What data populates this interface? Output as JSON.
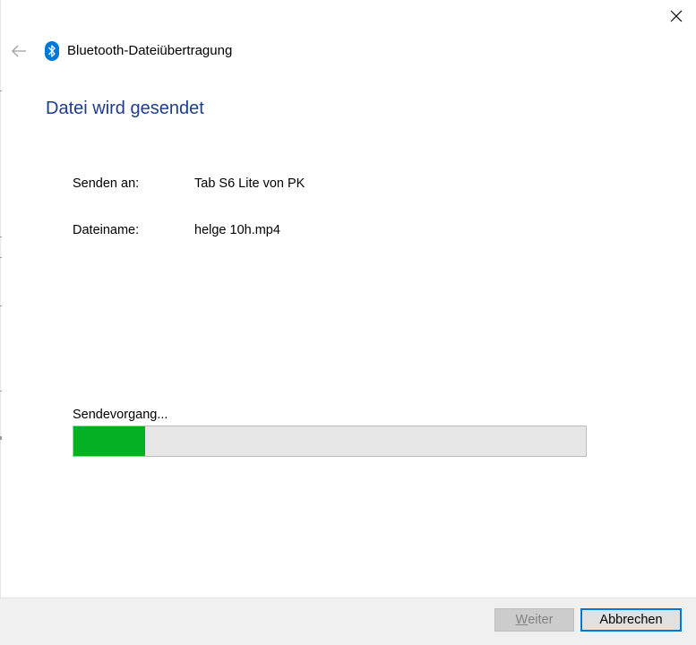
{
  "window": {
    "title": "Bluetooth-Dateiübertragung",
    "close_icon": "close-icon",
    "back_icon": "back-arrow-icon",
    "app_icon": "bluetooth-icon",
    "accent_color": "#0078d7"
  },
  "main": {
    "heading": "Datei wird gesendet",
    "heading_color": "#1e3c8f",
    "fields": [
      {
        "label": "Senden an:",
        "value": "Tab S6 Lite von PK"
      },
      {
        "label": "Dateiname:",
        "value": "helge 10h.mp4"
      }
    ],
    "progress": {
      "label": "Sendevorgang...",
      "percent": 14,
      "fill_color": "#06b025"
    }
  },
  "footer": {
    "next_label_mnemonic": "W",
    "next_label_rest": "eiter",
    "next_enabled": false,
    "cancel_label": "Abbrechen"
  }
}
